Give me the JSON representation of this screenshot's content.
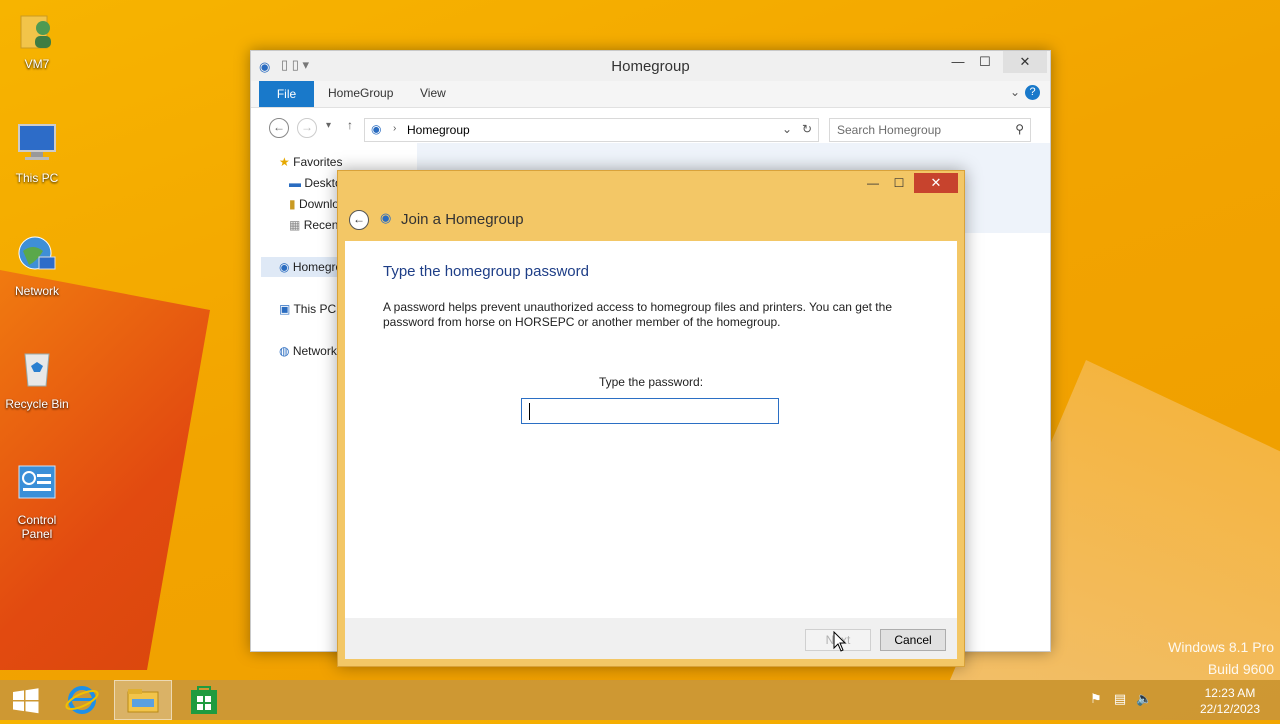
{
  "desktop": {
    "icons": [
      {
        "label": "VM7"
      },
      {
        "label": "This PC"
      },
      {
        "label": "Network"
      },
      {
        "label": "Recycle Bin"
      },
      {
        "label": "Control Panel"
      }
    ],
    "watermark": {
      "line1": "Windows 8.1 Pro",
      "line2": "Build 9600"
    }
  },
  "explorer": {
    "title": "Homegroup",
    "ribbon": {
      "file": "File",
      "tab1": "HomeGroup",
      "tab2": "View"
    },
    "address": {
      "location": "Homegroup",
      "search_placeholder": "Search Homegroup"
    },
    "nav": {
      "favorites": "Favorites",
      "desktop": "Desktop",
      "downloads": "Downloads",
      "recent": "Recent places",
      "homegroup": "Homegroup",
      "this_pc": "This PC",
      "network": "Network"
    }
  },
  "dialog": {
    "header": "Join a Homegroup",
    "heading": "Type the homegroup password",
    "description": "A password helps prevent unauthorized access to homegroup files and printers. You can get the password from horse on HORSEPC or another member of the homegroup.",
    "password_label": "Type the password:",
    "password_value": "",
    "next_label": "Next",
    "cancel_label": "Cancel",
    "close": "✕",
    "minimize": "—",
    "maximize": "☐"
  },
  "taskbar": {
    "clock": {
      "time": "12:23 AM",
      "date": "22/12/2023"
    }
  },
  "colors": {
    "accent": "#1979ca",
    "dialog_frame": "#f3c766",
    "close_button": "#c7432d",
    "heading": "#1e3e87"
  }
}
